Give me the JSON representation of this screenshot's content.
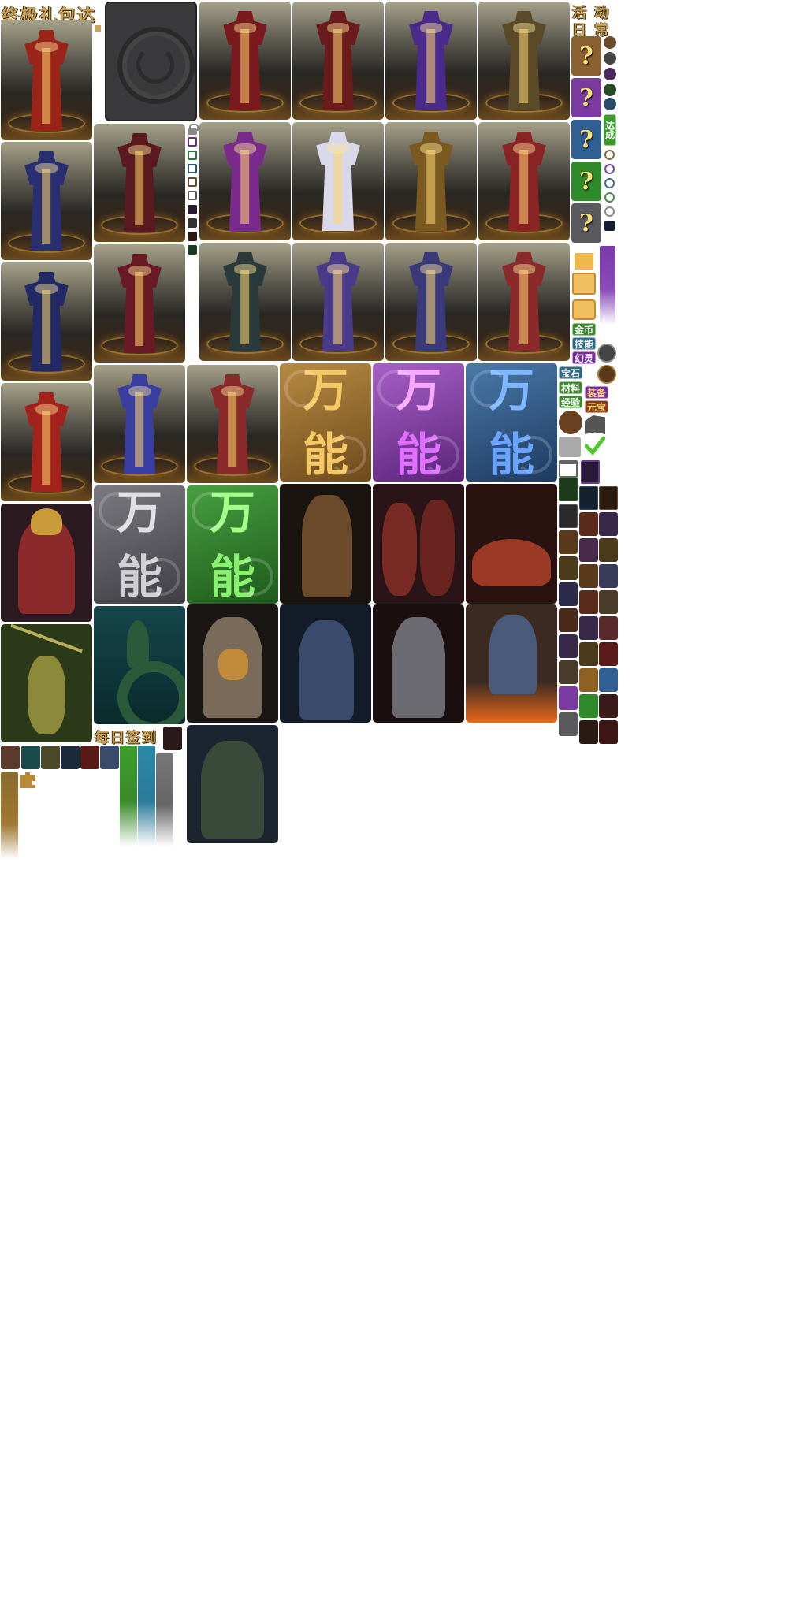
{
  "labels": {
    "ultimate_pack_title": "终极礼包达成",
    "activity_title_1": "活 动",
    "activity_title_2": "日 常",
    "achieved_label": "达成",
    "daily_signin_title": "每日签到",
    "wan_char_1": "万",
    "wan_char_2": "能",
    "question_mark": "?",
    "tags": {
      "gold": "金币",
      "skill": "技能",
      "phantom": "幻灵",
      "gem": "宝石",
      "material": "材料",
      "experience": "经验",
      "equipment": "装备",
      "ingot": "元宝"
    }
  },
  "colors": {
    "title_gold": "#c9a35a",
    "wan_gold": "#8e6024",
    "wan_purple": "#7a3aa0",
    "wan_blue": "#2f5f93",
    "wan_gray": "#5a5a5e",
    "wan_green": "#2f8a2a",
    "check_green": "#4fc82a"
  },
  "armor_cards": [
    {
      "id": "armor-1",
      "robe": "#9a2418"
    },
    {
      "id": "armor-2",
      "robe": "#2a2f72"
    },
    {
      "id": "armor-3",
      "robe": "#222a66"
    },
    {
      "id": "armor-4",
      "robe": "#a4221c"
    },
    {
      "id": "armor-5",
      "robe": "#5a1a20"
    },
    {
      "id": "armor-6",
      "robe": "#6a1a24"
    },
    {
      "id": "armor-7",
      "robe": "#3a3ea0"
    },
    {
      "id": "armor-8",
      "robe": "#7a1a1e"
    },
    {
      "id": "armor-9",
      "robe": "#6a1c1c"
    },
    {
      "id": "armor-10",
      "robe": "#4a2a8a"
    },
    {
      "id": "armor-11",
      "robe": "#5a4a28"
    },
    {
      "id": "armor-12",
      "robe": "#7a2a8a"
    },
    {
      "id": "armor-13",
      "robe": "#d8d8e8"
    },
    {
      "id": "armor-14",
      "robe": "#7a5a20"
    },
    {
      "id": "armor-15",
      "robe": "#8a2424"
    },
    {
      "id": "armor-16",
      "robe": "#2a3a3a"
    },
    {
      "id": "armor-17",
      "robe": "#4a3a8a"
    },
    {
      "id": "armor-18",
      "robe": "#3a3a7a"
    },
    {
      "id": "armor-19",
      "robe": "#8a2a2a"
    }
  ],
  "monsters": [
    {
      "id": "monster-horned-warlord",
      "bg": "#2b1a20",
      "fg": "#8a2a2a"
    },
    {
      "id": "monster-mantis",
      "bg": "#2d3a1a",
      "fg": "#8a8a3a"
    },
    {
      "id": "monster-cobra",
      "bg": "#0e3a3a",
      "fg": "#2a5a3a"
    },
    {
      "id": "monster-armored-knight",
      "bg": "#1a1410",
      "fg": "#6a4a2a"
    },
    {
      "id": "monster-demon-pair",
      "bg": "#2a1418",
      "fg": "#7a2a24"
    },
    {
      "id": "monster-dragon-beast",
      "bg": "#2a1210",
      "fg": "#9a3a24"
    },
    {
      "id": "monster-ox-warrior",
      "bg": "#1a1614",
      "fg": "#7a6a5a"
    },
    {
      "id": "monster-blue-demon",
      "bg": "#141c2a",
      "fg": "#3a4a6a"
    },
    {
      "id": "monster-steel-golem",
      "bg": "#1a0e0e",
      "fg": "#6a6a70"
    },
    {
      "id": "monster-swordsman",
      "bg": "#3a2a22",
      "fg": "#c84a1a"
    },
    {
      "id": "monster-ogre",
      "bg": "#1c2430",
      "fg": "#3a4a3a"
    }
  ]
}
